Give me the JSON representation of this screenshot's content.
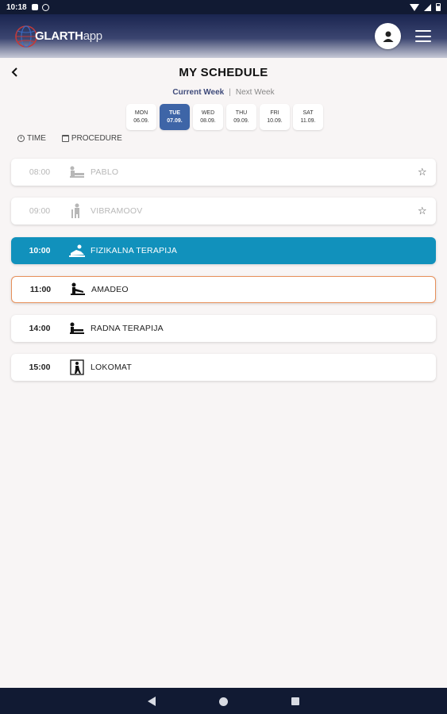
{
  "status_bar": {
    "time": "10:18"
  },
  "header": {
    "logo_text": "GLARTH",
    "logo_suffix": "app"
  },
  "page": {
    "title": "MY SCHEDULE",
    "current_week": "Current Week",
    "separator": "|",
    "next_week": "Next Week"
  },
  "days": [
    {
      "name": "MON",
      "date": "06.09.",
      "active": false
    },
    {
      "name": "TUE",
      "date": "07.09.",
      "active": true
    },
    {
      "name": "WED",
      "date": "08.09.",
      "active": false
    },
    {
      "name": "THU",
      "date": "09.09.",
      "active": false
    },
    {
      "name": "FRI",
      "date": "10.09.",
      "active": false
    },
    {
      "name": "SAT",
      "date": "11.09.",
      "active": false
    }
  ],
  "columns": {
    "time": "TIME",
    "procedure": "PROCEDURE"
  },
  "schedule": [
    {
      "time": "08:00",
      "name": "PABLO",
      "icon": "hand-therapy-icon",
      "state": "past",
      "favorite": true
    },
    {
      "time": "09:00",
      "name": "VIBRAMOOV",
      "icon": "standing-device-icon",
      "state": "past",
      "favorite": true
    },
    {
      "time": "10:00",
      "name": "FIZIKALNA TERAPIJA",
      "icon": "physical-therapy-icon",
      "state": "active",
      "favorite": false
    },
    {
      "time": "11:00",
      "name": "AMADEO",
      "icon": "amadeo-device-icon",
      "state": "highlight",
      "favorite": false
    },
    {
      "time": "14:00",
      "name": "RADNA TERAPIJA",
      "icon": "occupational-therapy-icon",
      "state": "normal",
      "favorite": false
    },
    {
      "time": "15:00",
      "name": "LOKOMAT",
      "icon": "lokomat-device-icon",
      "state": "normal",
      "favorite": false
    }
  ],
  "colors": {
    "active_row": "#1191bc",
    "highlight_border": "#e7905a",
    "active_day": "#3e65a7",
    "header_dark": "#1a2550"
  }
}
